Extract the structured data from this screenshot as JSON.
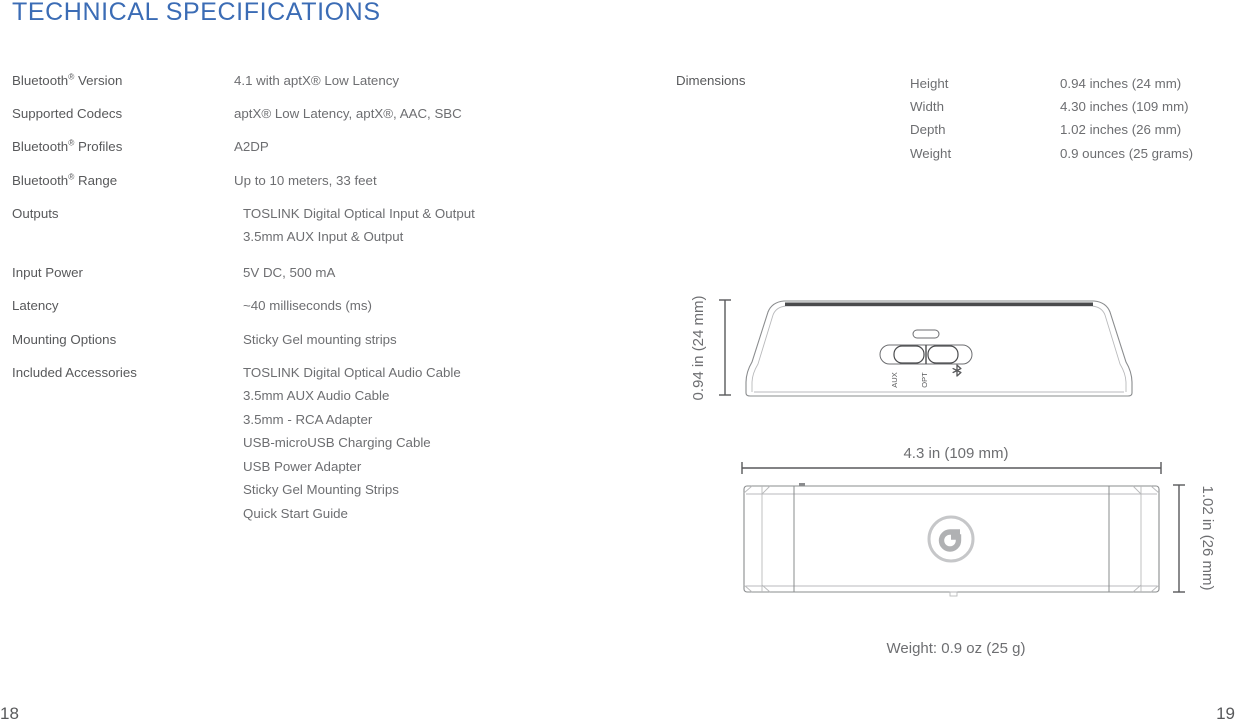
{
  "title": "TECHNICAL SPECIFICATIONS",
  "accent_color": "#3b6cb5",
  "text_color": "#58595b",
  "specs": [
    {
      "label_pre": "Bluetooth",
      "label_reg": "®",
      "label_post": " Version",
      "values": [
        "4.1 with aptX® Low Latency"
      ]
    },
    {
      "label_pre": "Supported Codecs",
      "label_reg": "",
      "label_post": "",
      "values": [
        "aptX® Low Latency, aptX®, AAC, SBC"
      ]
    },
    {
      "label_pre": "Bluetooth",
      "label_reg": "®",
      "label_post": " Profiles",
      "values": [
        "A2DP"
      ]
    },
    {
      "label_pre": "Bluetooth",
      "label_reg": "®",
      "label_post": " Range",
      "values": [
        "Up to 10 meters, 33 feet"
      ]
    },
    {
      "label_pre": "Outputs",
      "label_reg": "",
      "label_post": "",
      "values": [
        "TOSLINK Digital Optical Input & Output",
        "3.5mm AUX Input & Output"
      ]
    },
    {
      "label_pre": "Input Power",
      "label_reg": "",
      "label_post": "",
      "values": [
        "5V DC, 500 mA"
      ]
    },
    {
      "label_pre": "Latency",
      "label_reg": "",
      "label_post": "",
      "values": [
        "~40 milliseconds (ms)"
      ]
    },
    {
      "label_pre": "Mounting Options",
      "label_reg": "",
      "label_post": "",
      "values": [
        "Sticky Gel mounting strips"
      ]
    },
    {
      "label_pre": "Included Accessories",
      "label_reg": "",
      "label_post": "",
      "values": [
        "TOSLINK Digital Optical Audio Cable",
        "3.5mm AUX Audio Cable",
        "3.5mm - RCA Adapter",
        "USB-microUSB Charging Cable",
        "USB Power Adapter",
        "Sticky Gel Mounting Strips",
        "Quick Start Guide"
      ]
    }
  ],
  "dimensions": {
    "heading": "Dimensions",
    "keys": [
      "Height",
      "Width",
      "Depth",
      "Weight"
    ],
    "values": [
      "0.94 inches (24 mm)",
      "4.30 inches (109 mm)",
      "1.02 inches (26 mm)",
      "0.9 ounces (25 grams)"
    ]
  },
  "drawing": {
    "height_label": "0.94 in (24 mm)",
    "width_label": "4.3 in (109 mm)",
    "depth_label": "1.02 in (26 mm)",
    "switch_labels": [
      "AUX",
      "OPT",
      "ᛗ"
    ],
    "weight_caption": "Weight: 0.9 oz (25 g)"
  },
  "pages": {
    "left": "18",
    "right": "19"
  }
}
